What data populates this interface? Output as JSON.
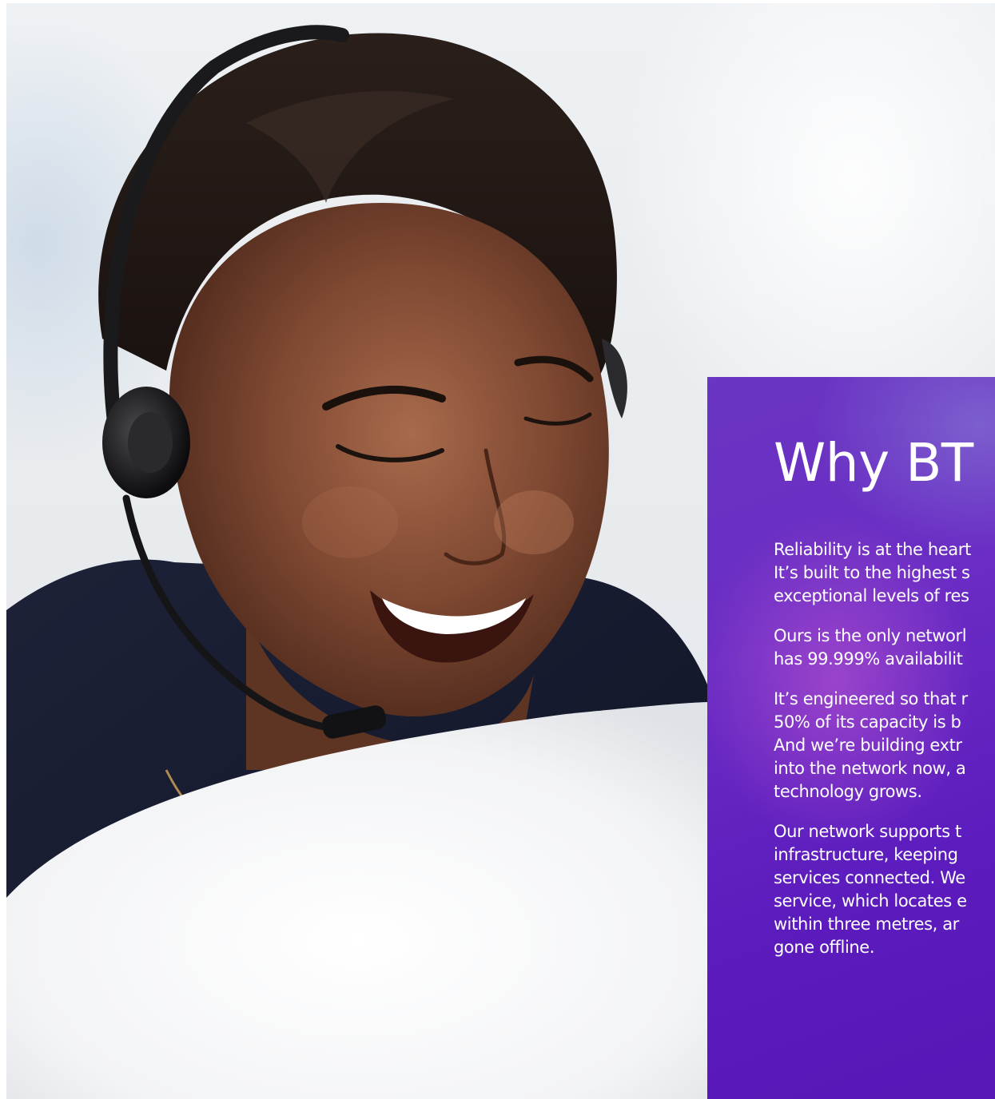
{
  "panel": {
    "title": "Why BT",
    "paragraphs": [
      [
        "Reliability is at the heart",
        "It’s built to the highest s",
        "exceptional levels of res"
      ],
      [
        "Ours is the only networl",
        "has 99.999% availabilit"
      ],
      [
        "It’s engineered so that r",
        "50% of its capacity is b",
        "And we’re building extr",
        "into the network now, a",
        "technology grows."
      ],
      [
        "Our network supports t",
        "infrastructure, keeping",
        "services connected. We",
        "service, which locates e",
        "within three metres, ar",
        "gone offline."
      ]
    ]
  },
  "photo": {
    "description_icon": "call-centre-agent-photo"
  },
  "colors": {
    "panel_purple": "#5c1bbd",
    "panel_text": "#ffffff"
  }
}
